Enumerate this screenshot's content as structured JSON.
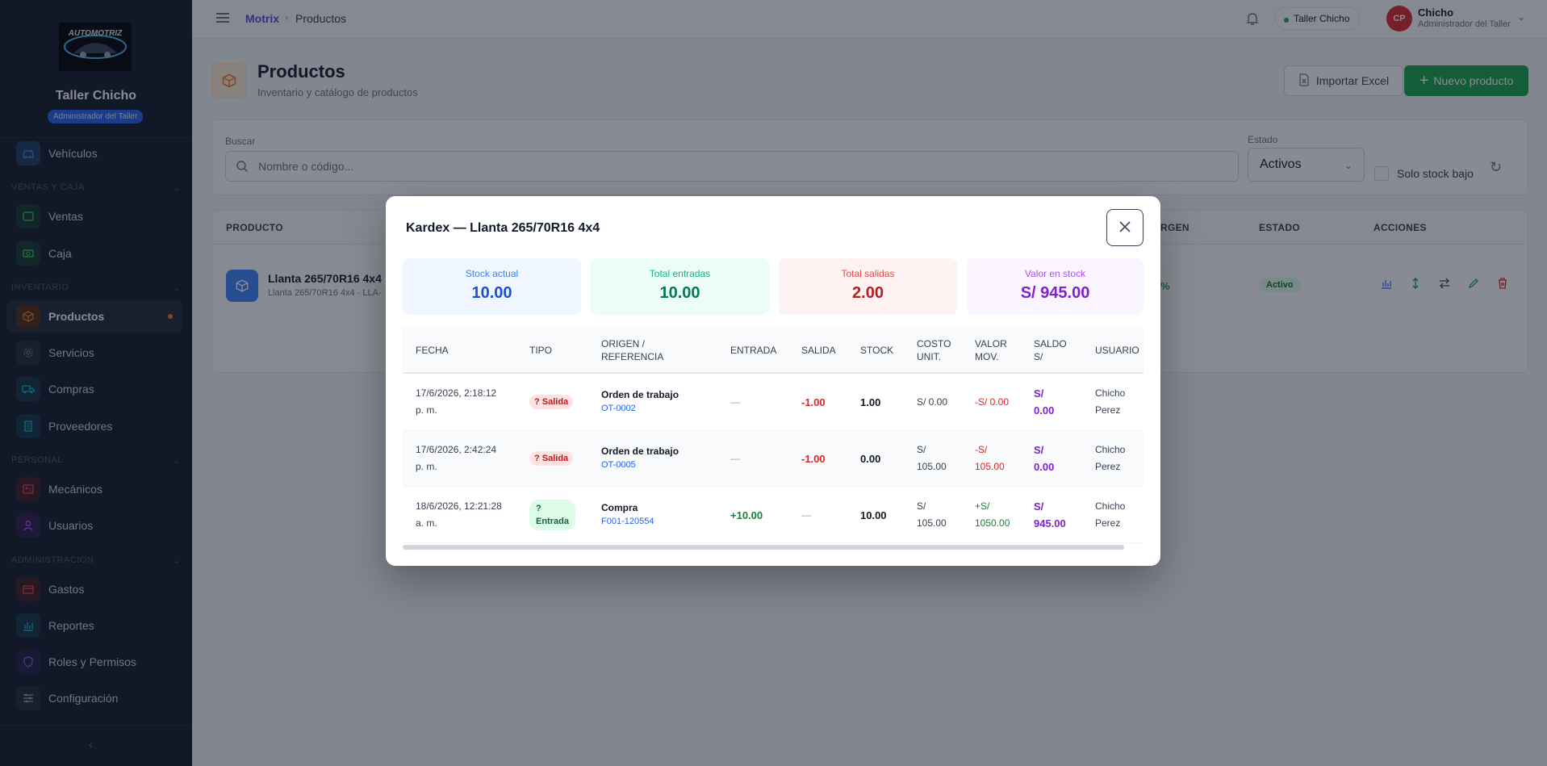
{
  "sidebar": {
    "logo_text": "AUTOMOTRIZ",
    "shop_name": "Taller Chicho",
    "role": "Administrador del Taller",
    "items": [
      {
        "label": "Vehículos"
      },
      {
        "label": "Ventas"
      },
      {
        "label": "Caja"
      },
      {
        "label": "Productos"
      },
      {
        "label": "Servicios"
      },
      {
        "label": "Compras"
      },
      {
        "label": "Proveedores"
      },
      {
        "label": "Mecánicos"
      },
      {
        "label": "Usuarios"
      },
      {
        "label": "Gastos"
      },
      {
        "label": "Reportes"
      },
      {
        "label": "Roles y Permisos"
      },
      {
        "label": "Configuración"
      }
    ],
    "sections": [
      "VENTAS Y CAJA",
      "INVENTARIO",
      "PERSONAL",
      "ADMINISTRACIÓN"
    ],
    "collapse_glyph": "‹"
  },
  "topbar": {
    "breadcrumb_root": "Motrix",
    "breadcrumb_sep": "›",
    "breadcrumb_current": "Productos",
    "shop_pill": "Taller Chicho",
    "avatar_initials": "CP",
    "user_name": "Chicho",
    "user_role": "Administrador del Taller"
  },
  "page": {
    "title": "Productos",
    "subtitle": "Inventario y catálogo de productos",
    "import_label": "Importar Excel",
    "new_label": "Nuevo producto"
  },
  "filters": {
    "search_label": "Buscar",
    "search_placeholder": "Nombre o código...",
    "estado_label": "Estado",
    "estado_value": "Activos",
    "low_stock_label": "Solo stock bajo"
  },
  "products_table": {
    "headers": {
      "producto": "PRODUCTO",
      "margen": "RGEN",
      "estado": "ESTADO",
      "acciones": "ACCIONES"
    },
    "row": {
      "name": "Llanta 265/70R16 4x4",
      "sub": "Llanta 265/70R16 4x4 · LLA-",
      "margen": "%",
      "estado": "Activo"
    }
  },
  "modal": {
    "title": "Kardex — Llanta 265/70R16 4x4",
    "stats": [
      {
        "label": "Stock actual",
        "value": "10.00",
        "bg": "#eff6ff",
        "label_color": "#3b82f6",
        "value_color": "#1d4ed8"
      },
      {
        "label": "Total entradas",
        "value": "10.00",
        "bg": "#ecfdf5",
        "label_color": "#10b981",
        "value_color": "#047857"
      },
      {
        "label": "Total salidas",
        "value": "2.00",
        "bg": "#fef2f2",
        "label_color": "#ef4444",
        "value_color": "#b91c1c"
      },
      {
        "label": "Valor en stock",
        "value": "S/ 945.00",
        "bg": "#faf5ff",
        "label_color": "#a855f7",
        "value_color": "#7e22ce"
      }
    ],
    "headers": {
      "fecha": "FECHA",
      "tipo": "TIPO",
      "origen_1": "ORIGEN /",
      "origen_2": "REFERENCIA",
      "entrada": "ENTRADA",
      "salida": "SALIDA",
      "stock": "STOCK",
      "costo_1": "COSTO",
      "costo_2": "UNIT.",
      "valor_1": "VALOR",
      "valor_2": "MOV.",
      "saldo_1": "SALDO",
      "saldo_2": "S/",
      "usuario": "USUARIO"
    },
    "rows": [
      {
        "fecha_1": "17/6/2026, 2:18:12",
        "fecha_2": "p. m.",
        "tipo_1": "? Salida",
        "tipo_2": "",
        "ref": "Orden de trabajo",
        "code": "OT-0002",
        "entrada": "—",
        "salida": "-1.00",
        "stock": "1.00",
        "costo_1": "S/ 0.00",
        "costo_2": "",
        "valor_1": "-S/ 0.00",
        "valor_2": "",
        "saldo_1": "S/",
        "saldo_2": "0.00",
        "user_1": "Chicho",
        "user_2": "Perez"
      },
      {
        "fecha_1": "17/6/2026, 2:42:24",
        "fecha_2": "p. m.",
        "tipo_1": "? Salida",
        "tipo_2": "",
        "ref": "Orden de trabajo",
        "code": "OT-0005",
        "entrada": "—",
        "salida": "-1.00",
        "stock": "0.00",
        "costo_1": "S/",
        "costo_2": "105.00",
        "valor_1": "-S/",
        "valor_2": "105.00",
        "saldo_1": "S/",
        "saldo_2": "0.00",
        "user_1": "Chicho",
        "user_2": "Perez"
      },
      {
        "fecha_1": "18/6/2026, 12:21:28",
        "fecha_2": "a. m.",
        "tipo_1": "?",
        "tipo_2": "Entrada",
        "ref": "Compra",
        "code": "F001-120554",
        "entrada": "+10.00",
        "salida": "—",
        "stock": "10.00",
        "costo_1": "S/",
        "costo_2": "105.00",
        "valor_1": "+S/",
        "valor_2": "1050.00",
        "saldo_1": "S/",
        "saldo_2": "945.00",
        "user_1": "Chicho",
        "user_2": "Perez"
      }
    ]
  }
}
